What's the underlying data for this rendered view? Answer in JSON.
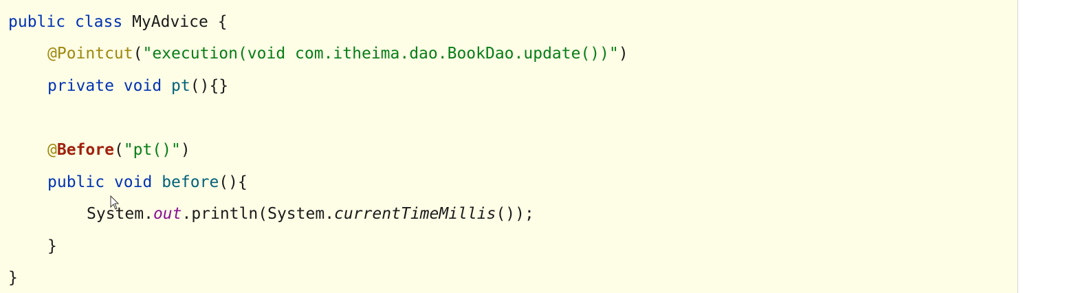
{
  "editor": {
    "lines": {
      "l1": {
        "kw1": "public",
        "kw2": "class",
        "name": "MyAdvice",
        "brace": "{"
      },
      "l2": {
        "ann": "@Pointcut",
        "open": "(",
        "str": "\"execution(void com.itheima.dao.BookDao.update())\"",
        "close": ")"
      },
      "l3": {
        "kw1": "private",
        "kw2": "void",
        "fn": "pt",
        "rest": "(){}"
      },
      "l5": {
        "at": "@",
        "ann": "Before",
        "open": "(",
        "str": "\"pt()\"",
        "close": ")"
      },
      "l6": {
        "kw1": "public",
        "kw2": "void",
        "fn": "before",
        "rest": "(){"
      },
      "l7": {
        "cls": "System.",
        "field": "out",
        "call": ".println(System.",
        "static": "currentTimeMillis",
        "end": "());"
      },
      "l8": {
        "brace": "}"
      },
      "l9": {
        "brace": "}"
      }
    }
  }
}
